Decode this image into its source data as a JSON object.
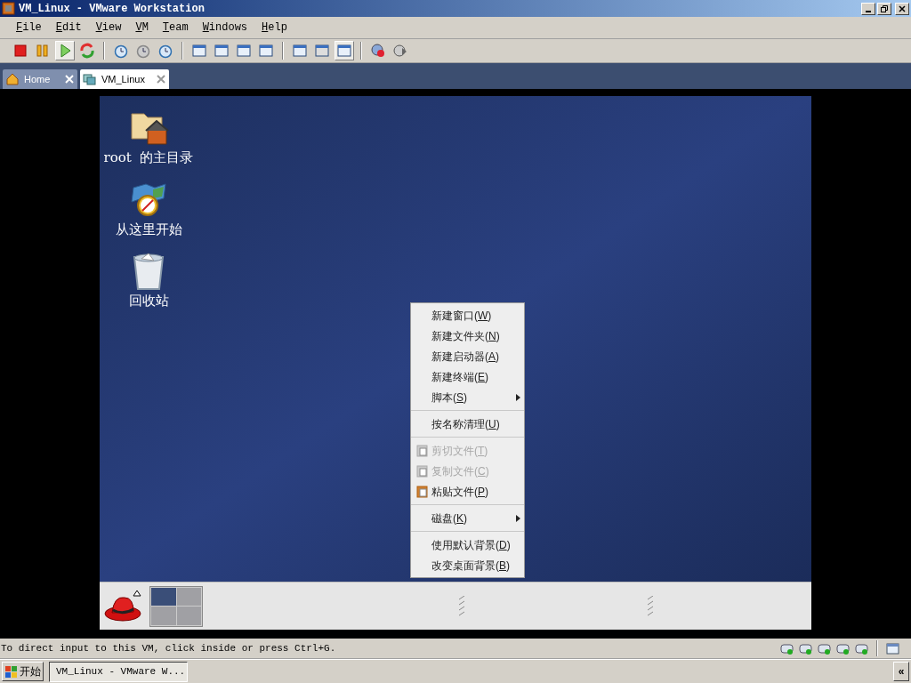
{
  "window": {
    "title": "VM_Linux - VMware Workstation"
  },
  "menubar": [
    "File",
    "Edit",
    "View",
    "VM",
    "Team",
    "Windows",
    "Help"
  ],
  "toolbar": [
    {
      "kind": "stop",
      "pressed": false
    },
    {
      "kind": "pause",
      "pressed": false
    },
    {
      "kind": "play",
      "pressed": true
    },
    {
      "kind": "reset",
      "pressed": false
    },
    {
      "kind": "sep"
    },
    {
      "kind": "snap-take",
      "pressed": false
    },
    {
      "kind": "snap-revert",
      "pressed": false
    },
    {
      "kind": "snap-manage",
      "pressed": false
    },
    {
      "kind": "sep"
    },
    {
      "kind": "view-sidebar",
      "pressed": false
    },
    {
      "kind": "view-fit",
      "pressed": false
    },
    {
      "kind": "view-full",
      "pressed": false
    },
    {
      "kind": "view-unity",
      "pressed": false
    },
    {
      "kind": "sep"
    },
    {
      "kind": "view-summary",
      "pressed": false
    },
    {
      "kind": "view-console",
      "pressed": false
    },
    {
      "kind": "view-quick",
      "pressed": true
    },
    {
      "kind": "sep"
    },
    {
      "kind": "record",
      "pressed": false
    },
    {
      "kind": "replay",
      "pressed": false
    }
  ],
  "tabs": [
    {
      "label": "Home",
      "kind": "home",
      "selected": false
    },
    {
      "label": "VM_Linux",
      "kind": "vm",
      "selected": true
    }
  ],
  "desktop_icons": [
    {
      "label": "root  的主目录",
      "kind": "home"
    },
    {
      "label": "从这里开始",
      "kind": "start"
    },
    {
      "label": "回收站",
      "kind": "trash"
    }
  ],
  "context_menu": [
    {
      "kind": "item",
      "label": "新建窗口(W)",
      "disabled": false,
      "submenu": false
    },
    {
      "kind": "item",
      "label": "新建文件夹(N)",
      "disabled": false,
      "submenu": false
    },
    {
      "kind": "item",
      "label": "新建启动器(A)",
      "disabled": false,
      "submenu": false
    },
    {
      "kind": "item",
      "label": "新建终端(E)",
      "disabled": false,
      "submenu": false
    },
    {
      "kind": "item",
      "label": "脚本(S)",
      "disabled": false,
      "submenu": true
    },
    {
      "kind": "separator"
    },
    {
      "kind": "item",
      "label": "按名称清理(U)",
      "disabled": false,
      "submenu": false
    },
    {
      "kind": "separator"
    },
    {
      "kind": "cut",
      "label": "剪切文件(T)",
      "disabled": true,
      "submenu": false
    },
    {
      "kind": "copy",
      "label": "复制文件(C)",
      "disabled": true,
      "submenu": false
    },
    {
      "kind": "paste",
      "label": "粘贴文件(P)",
      "disabled": false,
      "submenu": false
    },
    {
      "kind": "separator"
    },
    {
      "kind": "item",
      "label": "磁盘(K)",
      "disabled": false,
      "submenu": true
    },
    {
      "kind": "separator"
    },
    {
      "kind": "item",
      "label": "使用默认背景(D)",
      "disabled": false,
      "submenu": false
    },
    {
      "kind": "item",
      "label": "改变桌面背景(B)",
      "disabled": false,
      "submenu": false
    }
  ],
  "panel": {
    "workspaces": [
      {
        "selected": true
      },
      {
        "selected": false
      },
      {
        "selected": false
      },
      {
        "selected": false
      }
    ]
  },
  "status_bar": {
    "text": "To direct input to this VM, click inside or press Ctrl+G."
  },
  "taskbar": {
    "start": "开始",
    "tasks": [
      "VM_Linux - VMware W..."
    ],
    "tray_button": "«"
  }
}
